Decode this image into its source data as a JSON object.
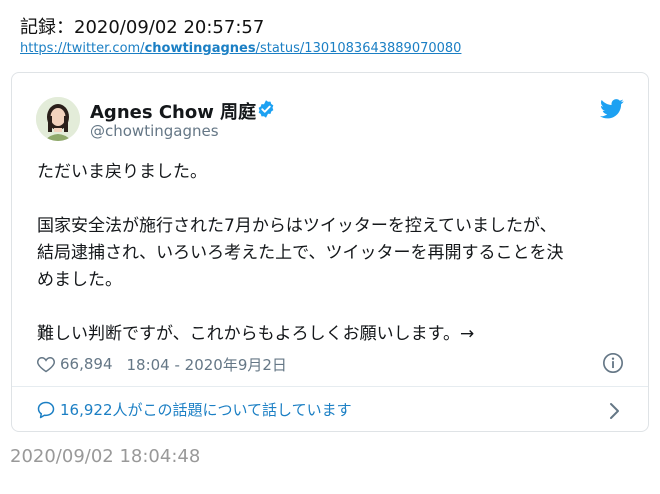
{
  "record": {
    "text": "記録：2020/09/02 20:57:57"
  },
  "source_link": {
    "prefix": "https://twitter.com/",
    "user": "chowtingagnes",
    "suffix": "/status/1301083643889070080"
  },
  "tweet": {
    "display_name": "Agnes Chow 周庭",
    "handle": "@chowtingagnes",
    "lines": [
      "ただいま戻りました。",
      "国家安全法が施行された7月からはツイッターを控えていましたが、",
      "結局逮捕され、いろいろ考えた上で、ツイッターを再開することを決",
      "めました。",
      "難しい判断ですが、これからもよろしくお願いします。→"
    ],
    "likes": "66,894",
    "time": "18:04 - 2020年9月2日",
    "conversation": "16,922人がこの話題について話しています"
  },
  "timestamp": {
    "text": "2020/09/02 18:04:48"
  },
  "icons": {
    "verified": "verified-badge-icon",
    "bird": "twitter-bird-icon",
    "heart": "heart-icon",
    "info": "info-icon",
    "bubble": "speech-bubble-icon",
    "chevron": "chevron-right-icon"
  },
  "colors": {
    "accent": "#1da1f2",
    "link": "#1b7fc4",
    "muted": "#657786",
    "border": "#dfe3e6"
  }
}
